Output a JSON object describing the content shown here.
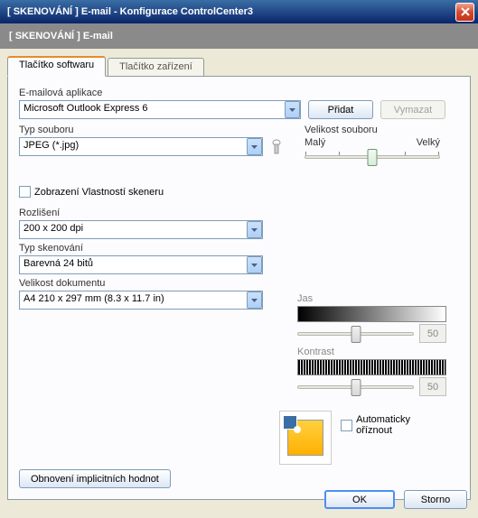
{
  "window": {
    "title": "[  SKENOVÁNÍ  ]   E-mail - Konfigurace ControlCenter3",
    "subheader": "[  SKENOVÁNÍ  ]   E-mail"
  },
  "tabs": {
    "software": "Tlačítko softwaru",
    "device": "Tlačítko zařízení"
  },
  "labels": {
    "email_app": "E-mailová aplikace",
    "file_type": "Typ souboru",
    "file_size": "Velikost souboru",
    "small": "Malý",
    "large": "Velký",
    "show_scanner": "Zobrazení Vlastností skeneru",
    "resolution": "Rozlišení",
    "scan_type": "Typ skenování",
    "doc_size": "Velikost dokumentu",
    "brightness": "Jas",
    "contrast": "Kontrast",
    "auto_crop": "Automaticky oříznout"
  },
  "values": {
    "email_app": "Microsoft Outlook Express 6",
    "file_type": "JPEG (*.jpg)",
    "resolution": "200 x 200 dpi",
    "scan_type": "Barevná 24 bitů",
    "doc_size": "A4 210 x 297 mm (8.3 x 11.7 in)",
    "brightness": "50",
    "contrast": "50"
  },
  "buttons": {
    "add": "Přidat",
    "delete": "Vymazat",
    "restore": "Obnovení implicitních hodnot",
    "ok": "OK",
    "cancel": "Storno"
  }
}
